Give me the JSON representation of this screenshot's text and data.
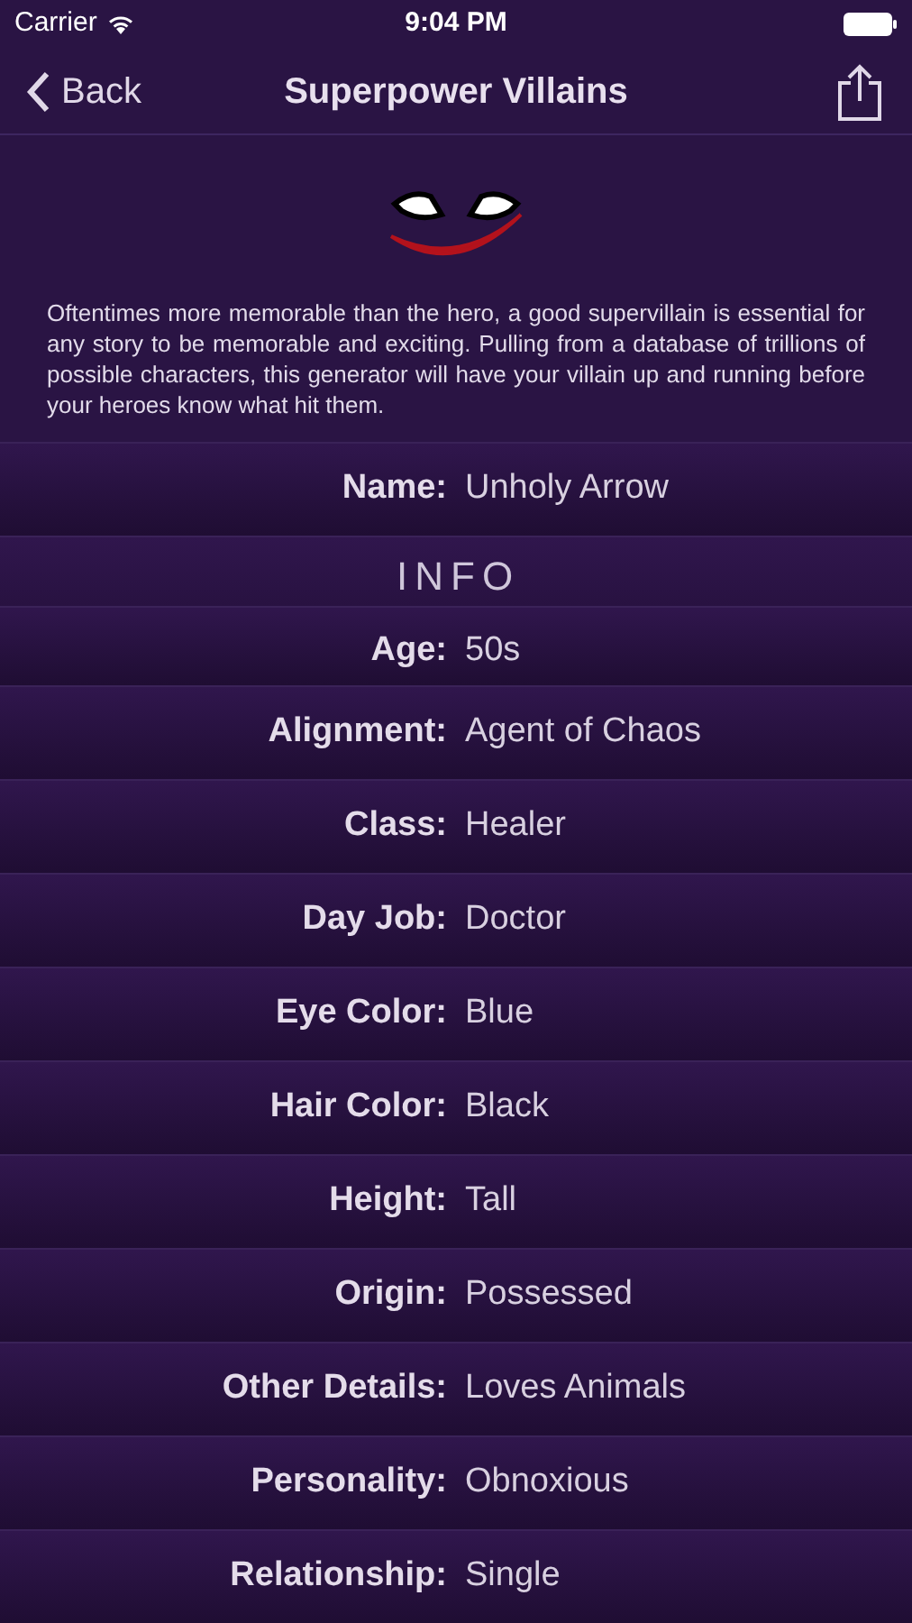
{
  "status_bar": {
    "carrier": "Carrier",
    "time": "9:04 PM"
  },
  "nav": {
    "back": "Back",
    "title": "Superpower Villains"
  },
  "description": "Oftentimes more memorable than the hero, a good supervillain is essential for any story to be memorable and exciting. Pulling from a database of trillions of possible characters, this generator will have your villain up and running before your heroes know what hit them.",
  "name_row": {
    "label": "Name:",
    "value": "Unholy Arrow"
  },
  "section_title": "INFO",
  "rows": [
    {
      "label": "Age:",
      "value": "50s"
    },
    {
      "label": "Alignment:",
      "value": "Agent of Chaos"
    },
    {
      "label": "Class:",
      "value": "Healer"
    },
    {
      "label": "Day Job:",
      "value": "Doctor"
    },
    {
      "label": "Eye Color:",
      "value": "Blue"
    },
    {
      "label": "Hair Color:",
      "value": "Black"
    },
    {
      "label": "Height:",
      "value": "Tall"
    },
    {
      "label": "Origin:",
      "value": "Possessed"
    },
    {
      "label": "Other Details:",
      "value": "Loves Animals"
    },
    {
      "label": "Personality:",
      "value": "Obnoxious"
    },
    {
      "label": "Relationship:",
      "value": "Single"
    }
  ]
}
